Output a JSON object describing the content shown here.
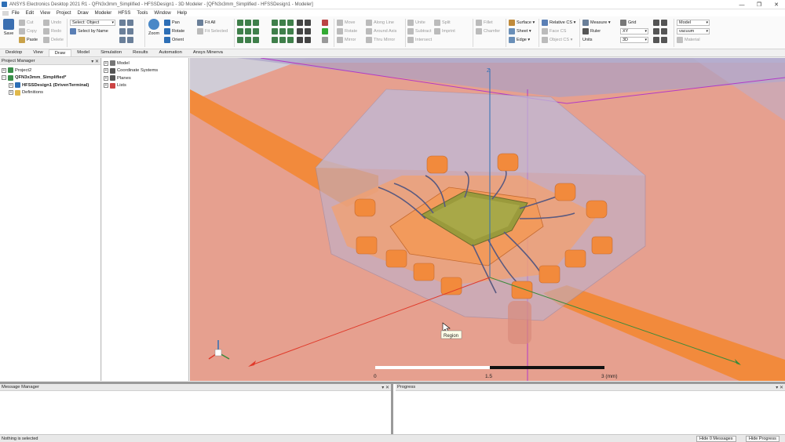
{
  "window": {
    "title": "ANSYS Electronics Desktop 2021 R1 - QFN3x3mm_Simplified - HFSSDesign1 - 3D Modeler - [QFN3x3mm_Simplified - HFSSDesign1 - Modeler]",
    "controls": [
      "—",
      "❐",
      "✕"
    ]
  },
  "menu": [
    "File",
    "Edit",
    "View",
    "Project",
    "Draw",
    "Modeler",
    "HFSS",
    "Tools",
    "Window",
    "Help"
  ],
  "ribbon": {
    "save": "Save",
    "cut": "Cut",
    "copy": "Copy",
    "paste": "Paste",
    "undo": "Undo",
    "redo": "Redo",
    "delete": "Delete",
    "select_value": "Select: Object",
    "select_by_name": "Select by Name",
    "zoom": "Zoom",
    "pan": "Pan",
    "rotate": "Rotate",
    "orient": "Orient",
    "fit_all": "Fit All",
    "fit_selected": "Fit Selected",
    "move": "Move",
    "rotate2": "Rotate",
    "mirror": "Mirror",
    "along_line": "Along Line",
    "around_axis": "Around Axis",
    "thru_mirror": "Thru Mirror",
    "unite": "Unite",
    "subtract": "Subtract",
    "intersect": "Intersect",
    "split": "Split",
    "imprint": "Imprint",
    "fillet": "Fillet",
    "chamfer": "Chamfer",
    "surface": "Surface",
    "sheet": "Sheet",
    "edge": "Edge",
    "relative_cs": "Relative CS",
    "face_cs": "Face CS",
    "object_cs": "Object CS",
    "measure": "Measure",
    "ruler": "Ruler",
    "units": "Units",
    "grid": "Grid",
    "plane_value": "XY",
    "dim_value": "3D",
    "model_value": "Model",
    "material_value": "vacuum",
    "material": "Material"
  },
  "tabs": [
    "Desktop",
    "View",
    "Draw",
    "Model",
    "Simulation",
    "Results",
    "Automation",
    "Ansys Minerva"
  ],
  "active_tab": "Draw",
  "project_manager": {
    "title": "Project Manager",
    "controls": "▾ ✕",
    "items": [
      {
        "label": "Project2",
        "level": 0,
        "exp": "+"
      },
      {
        "label": "QFN3x3mm_Simplified*",
        "level": 0,
        "exp": "−",
        "bold": true
      },
      {
        "label": "HFSSDesign1 (DrivenTerminal)",
        "level": 1,
        "exp": "+",
        "bold": true
      },
      {
        "label": "Definitions",
        "level": 1,
        "exp": "+"
      }
    ]
  },
  "model_tree": {
    "items": [
      {
        "label": "Model",
        "exp": "+"
      },
      {
        "label": "Coordinate Systems",
        "exp": "+"
      },
      {
        "label": "Planes",
        "exp": "+"
      },
      {
        "label": "Lists",
        "exp": "+"
      }
    ]
  },
  "viewport": {
    "tooltip": "Region",
    "axis_label": "Z",
    "scale_labels": [
      "0",
      "1.5",
      "3 (mm)"
    ]
  },
  "message_manager": {
    "title": "Message Manager",
    "controls": "▾ ✕"
  },
  "progress": {
    "title": "Progress",
    "controls": "▾ ✕"
  },
  "status": {
    "text": "Nothing is selected",
    "hide_messages": "Hide 0 Messages",
    "hide_progress": "Hide Progress"
  },
  "colors": {
    "accent": "#2e6fb6",
    "background_plane": "#e6a08f",
    "trace": "#f28a3c",
    "region": "#b9b3d3",
    "die": "#9a9a3c"
  }
}
